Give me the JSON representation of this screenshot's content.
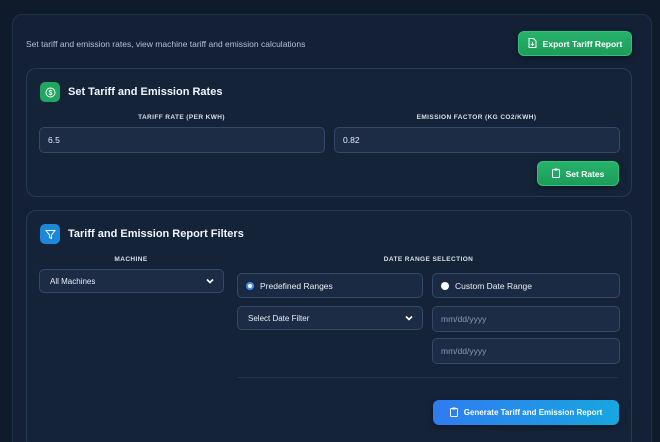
{
  "header": {
    "subtitle": "Set tariff and emission rates, view machine tariff and emission calculations",
    "export_label": "Export Tariff Report"
  },
  "rates_card": {
    "title": "Set Tariff and Emission Rates",
    "tariff_label": "TARIFF RATE (PER KWH)",
    "tariff_value": "6.5",
    "emission_label": "EMISSION FACTOR (KG CO2/KWH)",
    "emission_value": "0.82",
    "set_rates_label": "Set Rates"
  },
  "filters_card": {
    "title": "Tariff and Emission Report Filters",
    "machine_label": "MACHINE",
    "machine_value": "All Machines",
    "date_range_label": "DATE RANGE SELECTION",
    "predefined_label": "Predefined Ranges",
    "custom_label": "Custom Date Range",
    "date_filter_value": "Select Date Filter",
    "start_date_placeholder": "mm/dd/yyyy",
    "end_date_placeholder": "mm/dd/yyyy",
    "generate_label": "Generate Tariff and Emission Report"
  },
  "icons": {
    "export": "file-export-icon",
    "rates": "dollar-icon",
    "filters": "filter-icon",
    "set_rates": "clipboard-icon",
    "generate": "clipboard-icon"
  },
  "colors": {
    "accent_green": "#1fa65f",
    "accent_blue": "#2f7cf0",
    "background": "#0f1a2b"
  }
}
